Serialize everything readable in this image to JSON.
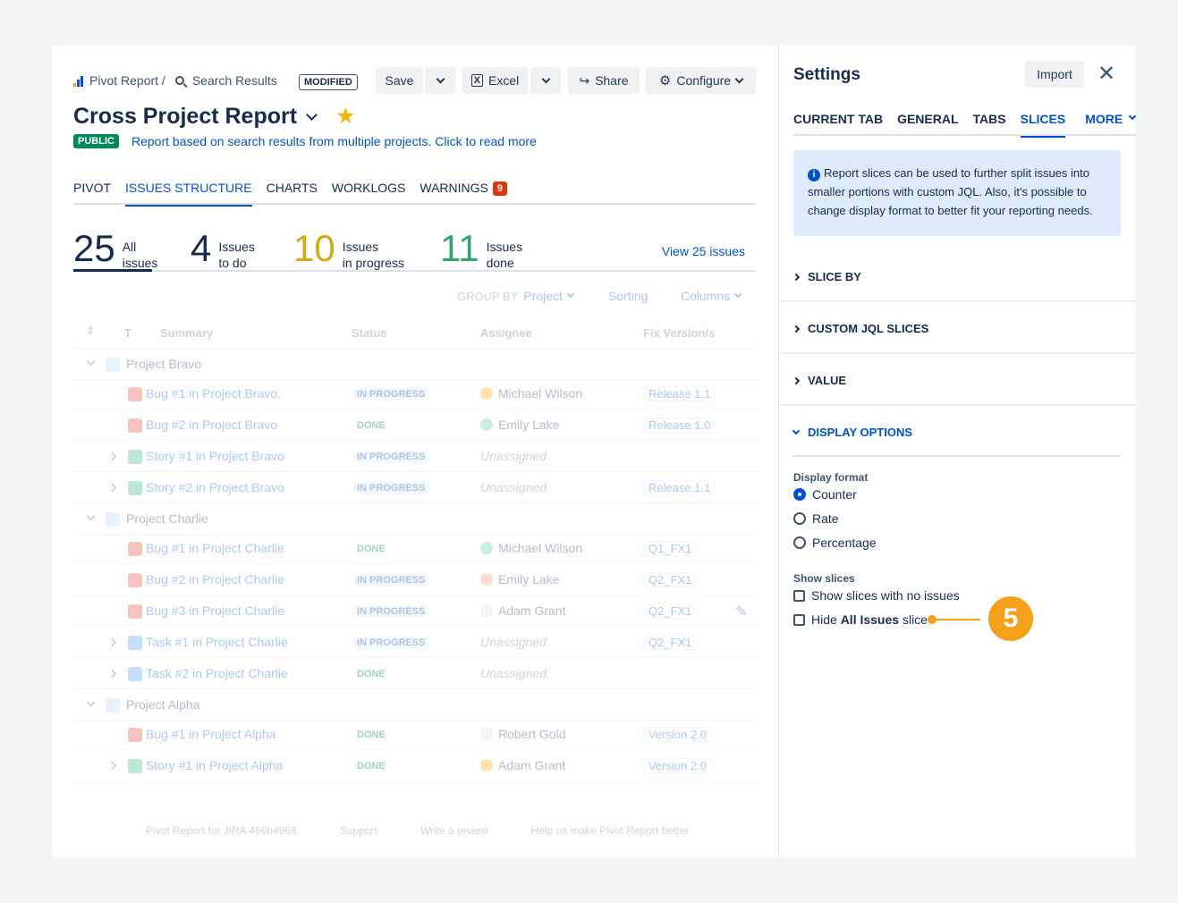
{
  "breadcrumb": {
    "app": "Pivot Report /",
    "page": "Search Results"
  },
  "modified_badge": "MODIFIED",
  "toolbar": {
    "save": "Save",
    "excel": "Excel",
    "share": "Share",
    "configure": "Configure"
  },
  "report": {
    "title": "Cross Project Report",
    "visibility": "PUBLIC",
    "description": "Report based on search results from multiple projects. Click to read more"
  },
  "tabs": [
    {
      "label": "PIVOT"
    },
    {
      "label": "ISSUES STRUCTURE"
    },
    {
      "label": "CHARTS"
    },
    {
      "label": "WORKLOGS"
    },
    {
      "label": "WARNINGS",
      "badge": "9"
    }
  ],
  "stats": [
    {
      "value": "25",
      "line1": "All",
      "line2": "issues",
      "color": "#172b4d"
    },
    {
      "value": "4",
      "line1": "Issues",
      "line2": "to do",
      "color": "#172b4d"
    },
    {
      "value": "10",
      "line1": "Issues",
      "line2": "in progress",
      "color": "#d4a817"
    },
    {
      "value": "11",
      "line1": "Issues",
      "line2": "done",
      "color": "#36a06e"
    }
  ],
  "view_all": "View 25 issues",
  "grouping": {
    "label": "GROUP BY",
    "value": "Project",
    "sorting": "Sorting",
    "columns": "Columns"
  },
  "table": {
    "headers": {
      "type": "T",
      "summary": "Summary",
      "status": "Status",
      "assignee": "Assignee",
      "fix": "Fix Version/s"
    },
    "rows": [
      {
        "kind": "project",
        "name": "Project Bravo"
      },
      {
        "kind": "issue",
        "type": "bug",
        "summary": "Bug #1 in Project Bravo.",
        "status": "IN PROGRESS",
        "assignee": "Michael Wilson",
        "fix": "Release 1.1"
      },
      {
        "kind": "issue",
        "type": "bug",
        "summary": "Bug #2 in Project Bravo",
        "status": "DONE",
        "assignee": "Emily Lake",
        "fix": "Release 1.0"
      },
      {
        "kind": "issue",
        "type": "story",
        "expand": true,
        "summary": "Story #1 in Project Bravo",
        "status": "IN PROGRESS",
        "assignee": "Unassigned",
        "fix": ""
      },
      {
        "kind": "issue",
        "type": "story",
        "expand": true,
        "summary": "Story #2 in Project Bravo",
        "status": "IN PROGRESS",
        "assignee": "Unassigned",
        "fix": "Release 1.1"
      },
      {
        "kind": "project",
        "name": "Project Charlie"
      },
      {
        "kind": "issue",
        "type": "bug",
        "summary": "Bug #1 in Project Charlie",
        "status": "DONE",
        "assignee": "Michael Wilson",
        "fix": "Q1_FX1"
      },
      {
        "kind": "issue",
        "type": "bug",
        "summary": "Bug #2 in Project Charlie",
        "status": "IN PROGRESS",
        "assignee": "Emily Lake",
        "fix": "Q2_FX1"
      },
      {
        "kind": "issue",
        "type": "bug",
        "summary": "Bug #3 in Project Charlie",
        "status": "IN PROGRESS",
        "assignee": "Adam Grant",
        "fix": "Q2_FX1",
        "edit": true
      },
      {
        "kind": "issue",
        "type": "task",
        "expand": true,
        "summary": "Task #1 in Project Charlie",
        "status": "IN PROGRESS",
        "assignee": "Unassigned",
        "fix": "Q2_FX1"
      },
      {
        "kind": "issue",
        "type": "task",
        "expand": true,
        "summary": "Task #2 in Project Charlie",
        "status": "DONE",
        "assignee": "Unassigned",
        "fix": ""
      },
      {
        "kind": "project",
        "name": "Project Alpha"
      },
      {
        "kind": "issue",
        "type": "bug",
        "summary": "Bug #1 in Project Alpha",
        "status": "DONE",
        "assignee": "Robert Gold",
        "fix": "Version 2.0"
      },
      {
        "kind": "issue",
        "type": "story",
        "expand": true,
        "summary": "Story #1 in Project Alpha",
        "status": "DONE",
        "assignee": "Adam Grant",
        "fix": "Version 2.0"
      }
    ]
  },
  "footer": [
    "Pivot Report for JIRA 466b4968",
    "Support",
    "Write a review",
    "Help us make Pivot Report better"
  ],
  "settings": {
    "title": "Settings",
    "import": "Import",
    "tabs": [
      "CURRENT TAB",
      "GENERAL",
      "TABS",
      "SLICES",
      "MORE"
    ],
    "info": "Report slices can be used to further split issues into smaller portions with custom JQL. Also, it's possible to change display format to better fit your reporting needs.",
    "sections": [
      "SLICE BY",
      "CUSTOM JQL SLICES",
      "VALUE",
      "DISPLAY OPTIONS"
    ],
    "display_format_label": "Display format",
    "display_formats": [
      "Counter",
      "Rate",
      "Percentage"
    ],
    "show_slices_label": "Show slices",
    "show_no_issues": "Show slices with no issues",
    "hide_prefix": "Hide",
    "hide_bold": "All Issues",
    "hide_suffix": "slice"
  },
  "callout_number": "5",
  "colors": {
    "accent": "#0052cc",
    "callout": "#f5a01a",
    "public": "#00875a",
    "warning": "#de350b"
  }
}
